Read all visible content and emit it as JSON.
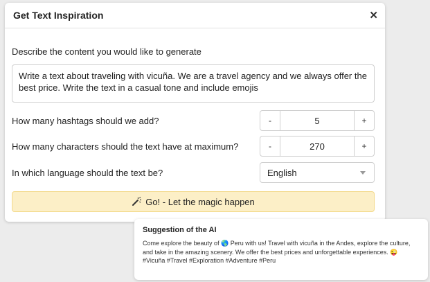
{
  "dialog": {
    "title": "Get Text Inspiration",
    "close_icon": "close-icon"
  },
  "content": {
    "label": "Describe the content you would like to generate",
    "value": "Write a text about traveling with vicuña. We are a travel agency and we always offer the best price. Write the text in a casual tone and include emojis"
  },
  "hashtags": {
    "label": "How many hashtags should we add?",
    "minus": "-",
    "value": "5",
    "plus": "+"
  },
  "characters": {
    "label": "How many characters should the text have at maximum?",
    "minus": "-",
    "value": "270",
    "plus": "+"
  },
  "language": {
    "label": "In which language should the text be?",
    "selected": "English"
  },
  "go_button": {
    "label": "Go! - Let the magic happen",
    "icon": "magic-wand-icon",
    "color": "#fcefc7"
  },
  "suggestion": {
    "title": "Suggestion of the AI",
    "text": "Come explore the beauty of 🌎 Peru with us! Travel with vicuña in the Andes, explore the culture, and take in the amazing scenery. We offer the best prices and unforgettable experiences. 😜 #Vicuña #Travel #Exploration #Adventure #Peru"
  }
}
